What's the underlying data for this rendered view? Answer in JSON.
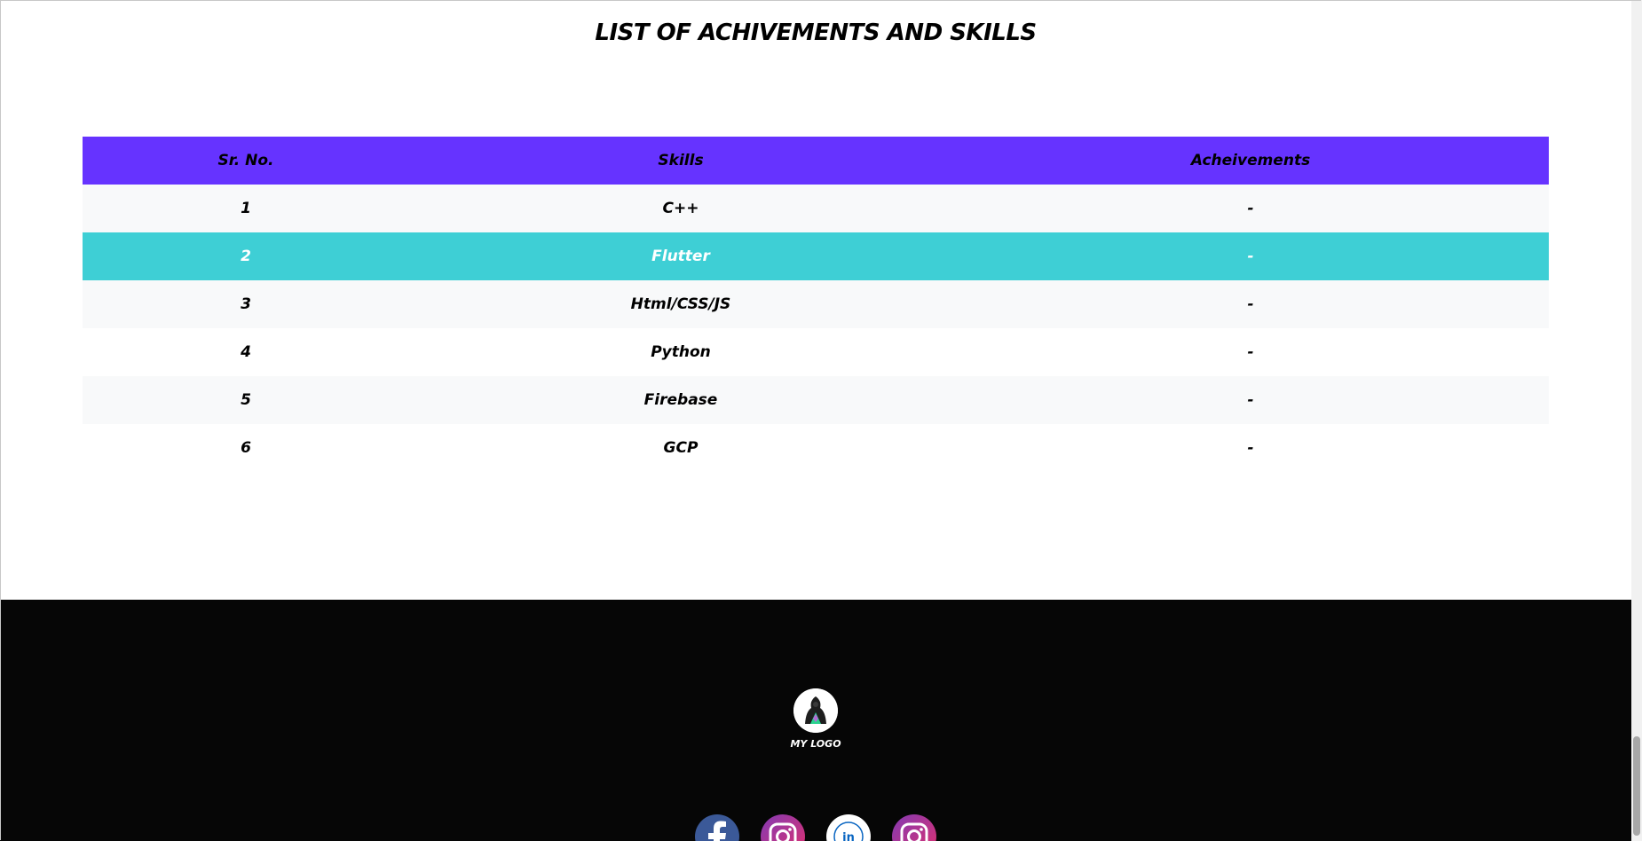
{
  "section": {
    "title": "LIST OF ACHIVEMENTS AND SKILLS"
  },
  "table": {
    "headers": {
      "sr_no": "Sr. No.",
      "skills": "Skills",
      "achievements": "Acheivements"
    },
    "rows": [
      {
        "sr": "1",
        "skill": "C++",
        "achievement": "-"
      },
      {
        "sr": "2",
        "skill": "Flutter",
        "achievement": "-"
      },
      {
        "sr": "3",
        "skill": "Html/CSS/JS",
        "achievement": "-"
      },
      {
        "sr": "4",
        "skill": "Python",
        "achievement": "-"
      },
      {
        "sr": "5",
        "skill": "Firebase",
        "achievement": "-"
      },
      {
        "sr": "6",
        "skill": "GCP",
        "achievement": "-"
      }
    ],
    "highlighted_row": "2"
  },
  "footer": {
    "logo_caption": "MY LOGO",
    "social_icons": [
      "facebook-icon",
      "instagram-icon",
      "linkedin-icon",
      "instagram-icon"
    ]
  },
  "colors": {
    "header_bg": "#6633ff",
    "highlight_row": "#3ecfd5",
    "footer_bg": "#060606"
  }
}
